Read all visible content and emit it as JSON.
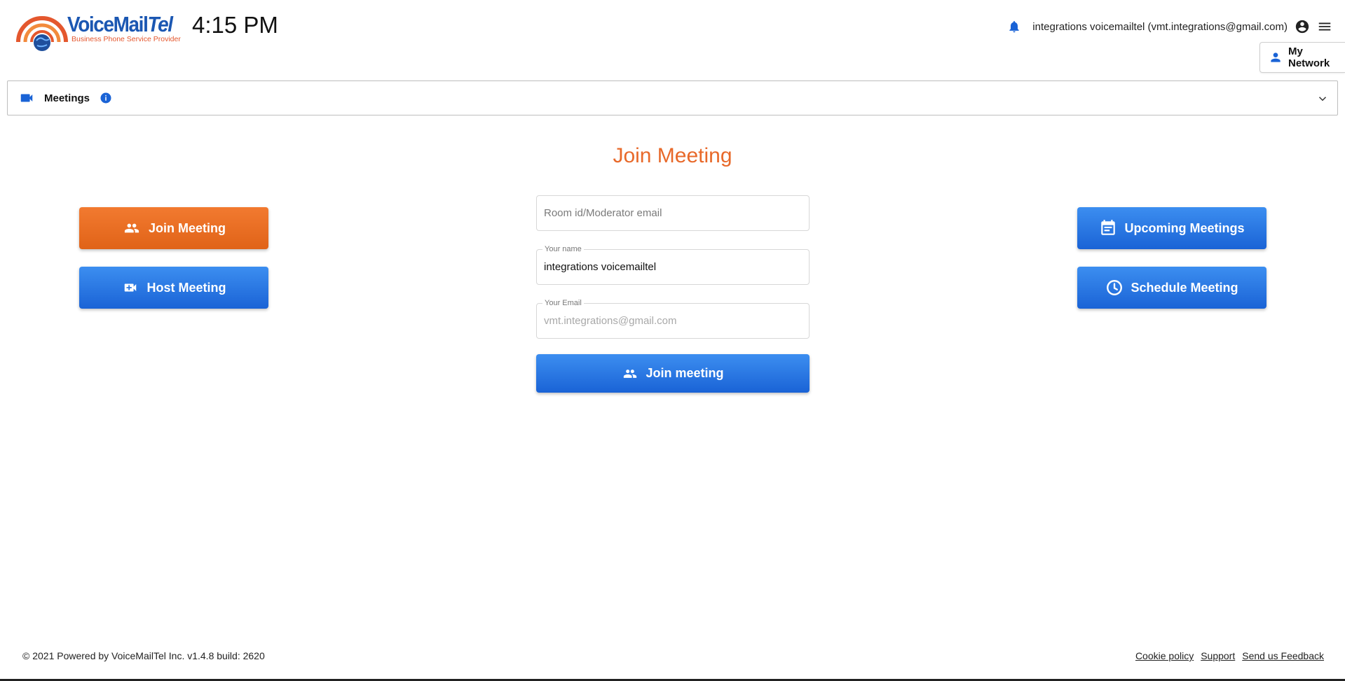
{
  "header": {
    "logo": {
      "brand_main": "VoiceMail",
      "brand_accent": "Tel",
      "tagline": "Business Phone Service Provider"
    },
    "time": "4:15 PM",
    "user_label": "integrations voicemailtel (vmt.integrations@gmail.com)",
    "icons": [
      "bell-icon",
      "account-circle-icon",
      "menu-icon"
    ],
    "my_network_label": "My Network"
  },
  "meetings_bar": {
    "label": "Meetings",
    "icons": [
      "videocam-icon",
      "info-icon",
      "chevron-down-icon"
    ]
  },
  "main": {
    "title": "Join Meeting",
    "room_field": {
      "placeholder": "Room id/Moderator email",
      "value": ""
    },
    "name_field": {
      "label": "Your name",
      "value": "integrations voicemailtel"
    },
    "email_field": {
      "label": "Your Email",
      "value": "vmt.integrations@gmail.com"
    },
    "submit_label": "Join meeting"
  },
  "left_actions": {
    "join_label": "Join Meeting",
    "host_label": "Host Meeting"
  },
  "right_actions": {
    "upcoming_label": "Upcoming Meetings",
    "schedule_label": "Schedule Meeting"
  },
  "footer": {
    "copyright": "© 2021 Powered by VoiceMailTel Inc. v1.4.8 build: 2620",
    "links": [
      "Cookie policy",
      "Support",
      "Send us Feedback"
    ]
  },
  "colors": {
    "accent_orange": "#e8692a",
    "primary_blue": "#1a63d6",
    "brand_blue": "#1b57b2"
  }
}
